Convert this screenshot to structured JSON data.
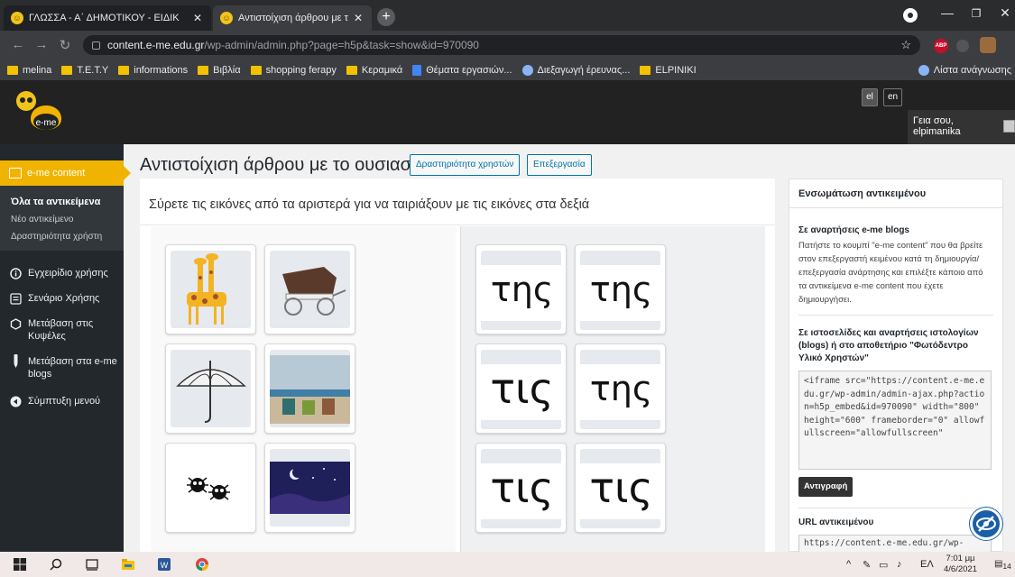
{
  "browser": {
    "tabs": [
      {
        "title": "ΓΛΩΣΣΑ - Α΄ ΔΗΜΟΤΙΚΟΥ - ΕΙΔΙΚ",
        "active": false
      },
      {
        "title": "Αντιστοίχιση άρθρου με το ουσι",
        "active": true
      }
    ],
    "url_host": "content.e-me.edu.gr",
    "url_path": "/wp-admin/admin.php?page=h5p&task=show&id=970090",
    "bookmarks": [
      "melina",
      "T.E.T.Y",
      "informations",
      "Βιβλία",
      "shopping ferapy",
      "Κεραμικά",
      "Θέματα εργασιών...",
      "Διεξαγωγή έρευνας...",
      "ELPINIKI"
    ],
    "reading_list": "Λίστα ανάγνωσης",
    "abp_label": "ABP"
  },
  "header": {
    "logo_text": "e-me",
    "languages": [
      "el",
      "en"
    ],
    "greeting": "Γεια σου, elpimanika"
  },
  "sidebar": {
    "top_item": "e-me content",
    "submenu": [
      "Όλα τα αντικείμενα",
      "Νέο αντικείμενο",
      "Δραστηριότητα χρήστη"
    ],
    "items": [
      "Εγχειρίδιο χρήσης",
      "Σενάριο Χρήσης",
      "Μετάβαση στις Κυψέλες",
      "Μετάβαση στα e-me blogs",
      "Σύμπτυξη μενού"
    ]
  },
  "main": {
    "title": "Αντιστοίχιση άρθρου με το ουσιαστικό",
    "btn_activity": "Δραστηριότητα χρηστών",
    "btn_edit": "Επεξεργασία",
    "instruction": "Σύρετε τις εικόνες από τα αριστερά για να ταιριάξουν με τις εικόνες στα δεξιά",
    "left_images": [
      "giraffes-image",
      "carriage-image",
      "umbrella-image",
      "beach-chairs-image",
      "spiders-image",
      "night-sky-image"
    ],
    "words": [
      "της",
      "της",
      "τις",
      "της",
      "τις",
      "τις"
    ]
  },
  "embed": {
    "title": "Ενσωμάτωση αντικειμένου",
    "blogs_heading": "Σε αναρτήσεις e-me blogs",
    "blogs_text": "Πατήστε το κουμπί \"e-me content\" που θα βρείτε στον επεξεργαστή κειμένου κατά τη δημιουργία/επεξεργασία ανάρτησης και επιλέξτε κάποιο από τα αντικείμενα e-me content που έχετε δημιουργήσει.",
    "sites_heading": "Σε ιστοσελίδες και αναρτήσεις ιστολογίων (blogs) ή στο αποθετήριο \"Φωτόδεντρο Υλικό Χρηστών\"",
    "code": "<iframe src=\"https://content.e-me.edu.gr/wp-admin/admin-ajax.php?action=h5p_embed&id=970090\" width=\"800\" height=\"600\" frameborder=\"0\" allowfullscreen=\"allowfullscreen\"",
    "copy_label": "Αντιγραφή",
    "url_heading": "URL αντικειμένου",
    "url_value": "https://content.e-me.edu.gr/wp-"
  },
  "taskbar": {
    "lang": "ΕΛ",
    "time": "7:01 μμ",
    "date": "4/6/2021",
    "notifications": "14"
  },
  "colors": {
    "accent": "#f0b400",
    "wp_dark": "#23282d",
    "link": "#0073aa"
  }
}
